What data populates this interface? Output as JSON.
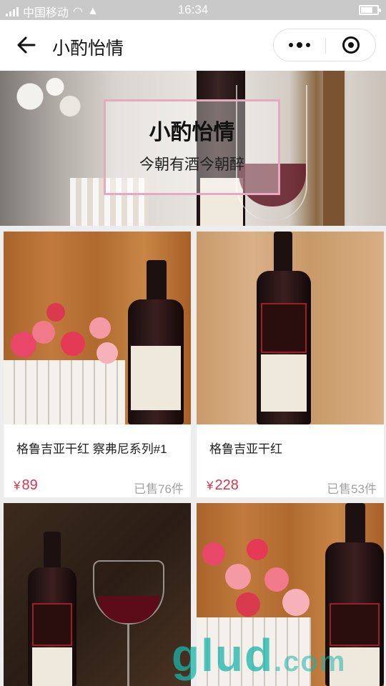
{
  "status_bar": {
    "carrier": "中国移动",
    "time": "16:34"
  },
  "nav": {
    "title": "小酌怡情"
  },
  "banner": {
    "title": "小酌怡情",
    "subtitle": "今朝有酒今朝醉"
  },
  "products": [
    {
      "name": "格鲁吉亚干红 察弗尼系列#1",
      "currency": "¥",
      "price": "89",
      "sold": "已售76件"
    },
    {
      "name": "格鲁吉亚干红",
      "currency": "¥",
      "price": "228",
      "sold": "已售53件"
    },
    {
      "name": "",
      "currency": "",
      "price": "",
      "sold": ""
    },
    {
      "name": "",
      "currency": "",
      "price": "",
      "sold": ""
    }
  ],
  "watermark": {
    "main": "glud",
    "suffix": ".com"
  },
  "colors": {
    "price": "#d6354c",
    "banner_frame": "#e6a9bf",
    "sold": "#a3a3a3"
  }
}
